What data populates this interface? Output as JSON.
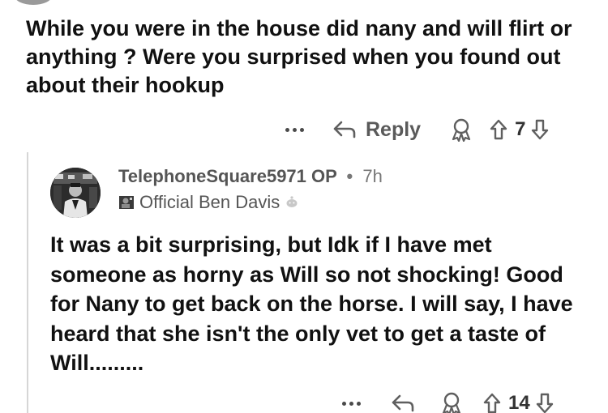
{
  "parent_comment": {
    "body": "While you were in the house did nany and will flirt or anything ? Were you surprised when you found out about their hookup",
    "actions": {
      "more_icon": "more-horizontal-icon",
      "reply_icon": "reply-arrow-icon",
      "reply_label": "Reply",
      "award_icon": "award-icon",
      "upvote_icon": "upvote-arrow-icon",
      "vote_count": "7",
      "downvote_icon": "downvote-arrow-icon"
    }
  },
  "reply_comment": {
    "author": "TelephoneSquare5971",
    "op_label": "OP",
    "separator": "•",
    "timestamp": "7h",
    "flair": {
      "text": "Official Ben Davis",
      "icon": "flair-badge-icon",
      "emoji_icon": "snoo-emoji-icon"
    },
    "body": "It was a bit surprising, but Idk if I have met someone as horny as Will so not shocking! Good for Nany to get back on the horse. I will say, I have heard that she isn't the only vet to get a taste of Will.........",
    "actions": {
      "more_icon": "more-horizontal-icon",
      "reply_icon": "reply-arrow-icon",
      "award_icon": "award-icon",
      "upvote_icon": "upvote-arrow-icon",
      "vote_count": "14",
      "downvote_icon": "downvote-arrow-icon"
    }
  },
  "colors": {
    "text": "#111111",
    "meta": "#555555",
    "icon": "#5f5f5f",
    "thread_line": "#d6d6d6",
    "background": "#ffffff"
  }
}
